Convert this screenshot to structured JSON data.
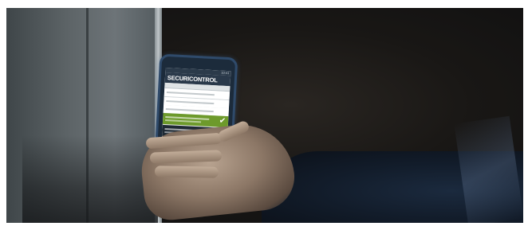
{
  "image": {
    "brand_text_prefix": "SECURI",
    "brand_text_suffix": "CONTROL",
    "status_text": "10:41",
    "colors": {
      "screen_bg": "#e9ecec",
      "ok_row": "#6d9a2b",
      "warn_icon": "#e08a1c",
      "phone_case": "#2f4a6a"
    },
    "icons": {
      "ok": "check-icon",
      "warn": "cross-icon"
    }
  }
}
